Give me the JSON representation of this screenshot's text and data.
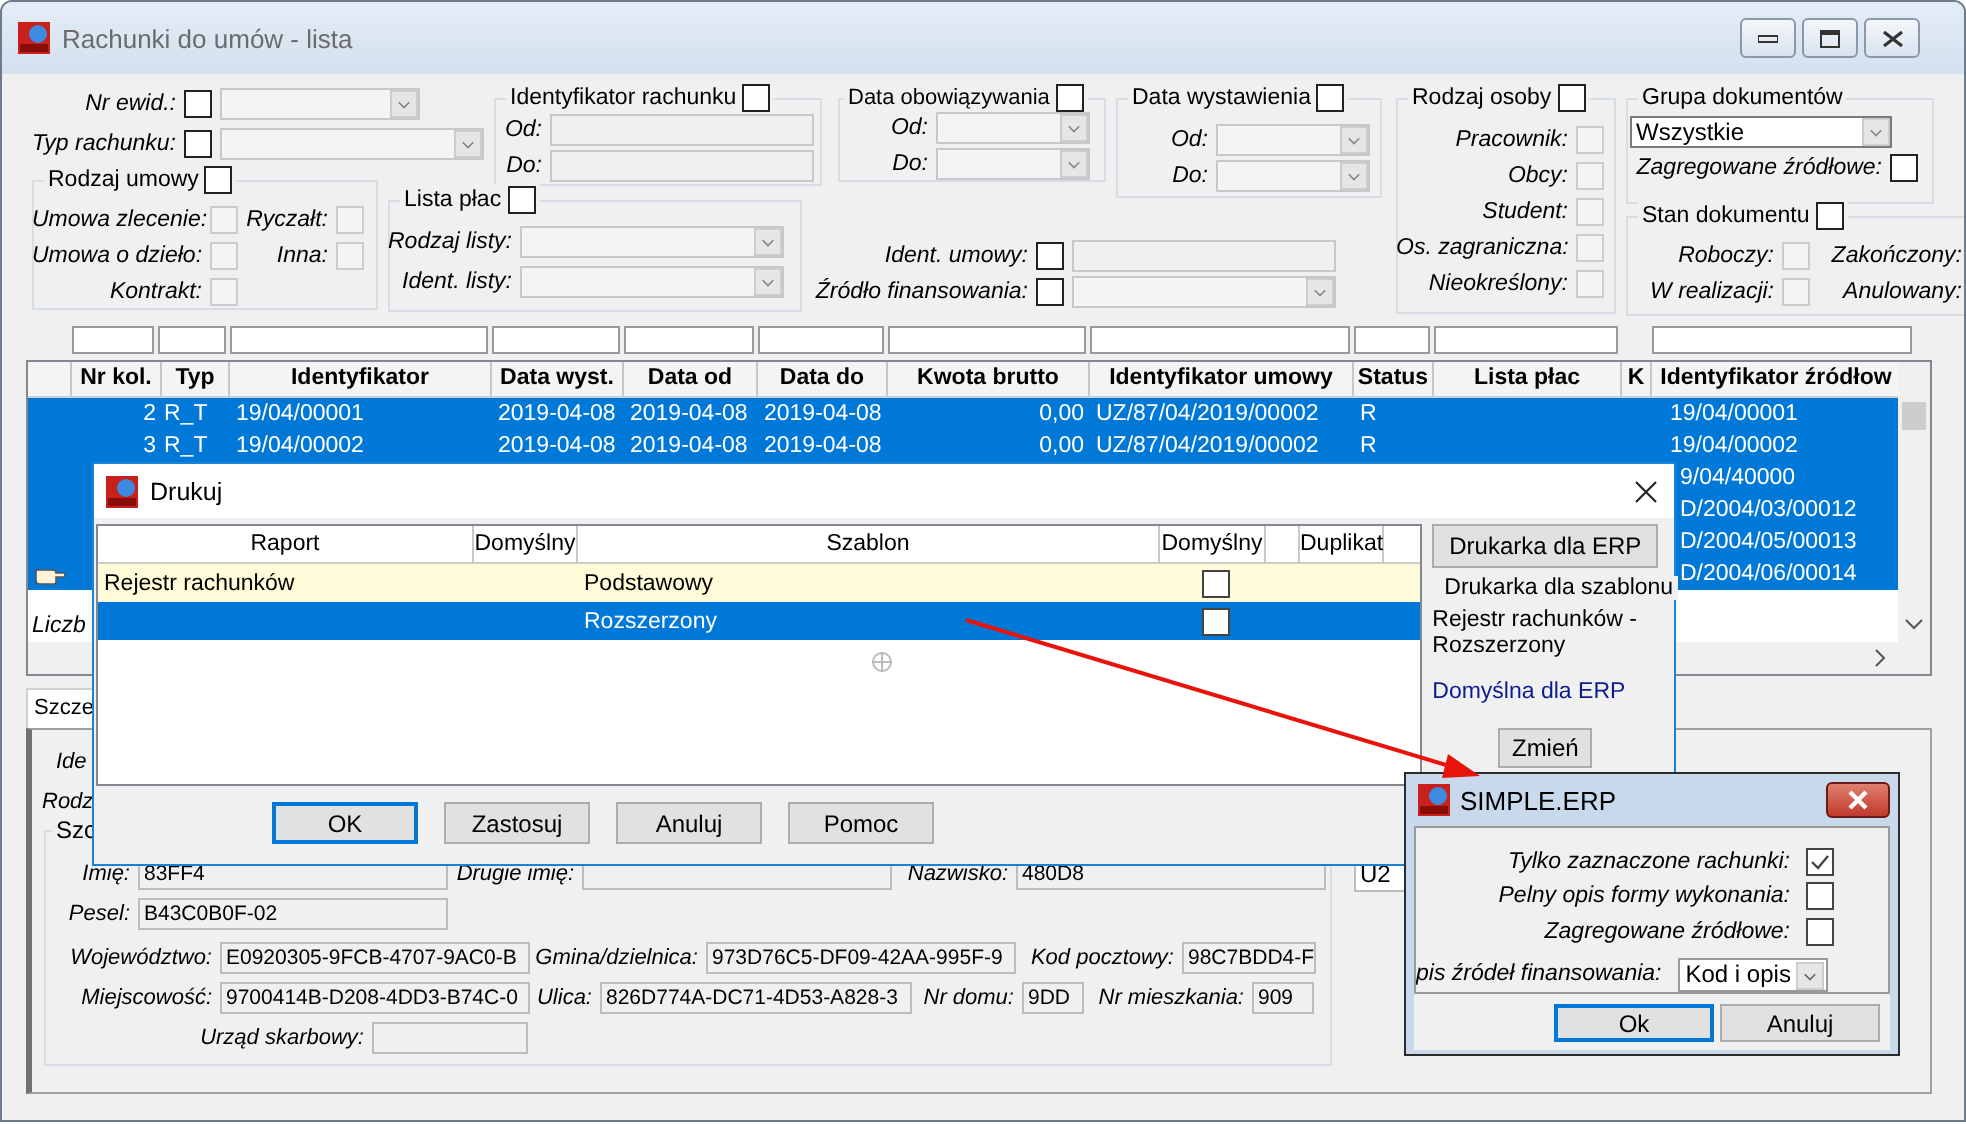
{
  "window": {
    "title": "Rachunki do umów - lista"
  },
  "filter_groups": [
    {
      "kind": "plain",
      "rows": [
        {
          "kind": "check-combo",
          "label": "Nr ewid.:",
          "checked": false,
          "disabled": true
        },
        {
          "kind": "check-combo",
          "label": "Typ rachunku:",
          "checked": false,
          "disabled": true
        }
      ]
    },
    {
      "kind": "box",
      "title": "Rodzaj umowy",
      "checked": false,
      "rows": [
        {
          "kind": "check",
          "label": "Umowa zlecenie:",
          "checked": false,
          "disabled": true
        },
        {
          "kind": "check",
          "label": "Ryczałt:",
          "checked": false,
          "disabled": true
        },
        {
          "kind": "check",
          "label": "Umowa o dzieło:",
          "checked": false,
          "disabled": true
        },
        {
          "kind": "check",
          "label": "Inna:",
          "checked": false,
          "disabled": true
        },
        {
          "kind": "check",
          "label": "Kontrakt:",
          "checked": false,
          "disabled": true
        }
      ]
    },
    {
      "kind": "box",
      "title": "Identyfikator rachunku",
      "checked": false,
      "rows": [
        {
          "kind": "text",
          "label": "Od:",
          "disabled": true
        },
        {
          "kind": "text",
          "label": "Do:",
          "disabled": true
        }
      ]
    },
    {
      "kind": "box",
      "title": "Lista płac",
      "checked": false,
      "rows": [
        {
          "kind": "combo",
          "label": "Rodzaj listy:",
          "disabled": true
        },
        {
          "kind": "combo",
          "label": "Ident. listy:",
          "disabled": true
        }
      ]
    },
    {
      "kind": "box",
      "title": "Data obowiązywania",
      "checked": false,
      "rows": [
        {
          "kind": "combo",
          "label": "Od:",
          "disabled": true
        },
        {
          "kind": "combo",
          "label": "Do:",
          "disabled": true
        }
      ]
    },
    {
      "kind": "plain",
      "rows": [
        {
          "kind": "check-text",
          "label": "Ident. umowy:",
          "checked": false,
          "disabled": true
        },
        {
          "kind": "check-combo",
          "label": "Źródło finansowania:",
          "checked": false,
          "disabled": true
        }
      ]
    },
    {
      "kind": "box",
      "title": "Data wystawienia",
      "checked": false,
      "rows": [
        {
          "kind": "combo",
          "label": "Od:",
          "disabled": true
        },
        {
          "kind": "combo",
          "label": "Do:",
          "disabled": true
        }
      ]
    },
    {
      "kind": "box",
      "title": "Rodzaj osoby",
      "checked": false,
      "rows": [
        {
          "kind": "check",
          "label": "Pracownik:",
          "checked": false,
          "disabled": true
        },
        {
          "kind": "check",
          "label": "Obcy:",
          "checked": false,
          "disabled": true
        },
        {
          "kind": "check",
          "label": "Student:",
          "checked": false,
          "disabled": true
        },
        {
          "kind": "check",
          "label": "Os. zagraniczna:",
          "checked": false,
          "disabled": true
        },
        {
          "kind": "check",
          "label": "Nieokreślony:",
          "checked": false,
          "disabled": true
        }
      ]
    },
    {
      "kind": "box",
      "title": "Grupa dokumentów",
      "rows": [
        {
          "kind": "combo",
          "value": "Wszystkie",
          "disabled": false
        },
        {
          "kind": "check",
          "label": "Zagregowane źródłowe:",
          "checked": false,
          "disabled": false
        }
      ]
    },
    {
      "kind": "box",
      "title": "Stan dokumentu",
      "checked": false,
      "rows": [
        {
          "kind": "check",
          "label": "Roboczy:",
          "checked": false,
          "disabled": true
        },
        {
          "kind": "label",
          "label": "Zakończony:"
        },
        {
          "kind": "check",
          "label": "W realizacji:",
          "checked": false,
          "disabled": true
        },
        {
          "kind": "label",
          "label": "Anulowany:"
        }
      ]
    }
  ],
  "table": {
    "columns": [
      "Nr kol.",
      "Typ",
      "Identyfikator",
      "Data wyst.",
      "Data od",
      "Data do",
      "Kwota brutto",
      "Identyfikator umowy",
      "Status",
      "Lista płac",
      "K",
      "Identyfikator źródłow"
    ],
    "rows": [
      {
        "selected": true,
        "current": false,
        "nr": "2",
        "typ": "R_T",
        "identyfikator": "19/04/00001",
        "data_wyst": "2019-04-08",
        "data_od": "2019-04-08",
        "data_do": "2019-04-08",
        "kwota": "0,00",
        "ident_umowy": "UZ/87/04/2019/00002",
        "status": "R",
        "zrodlowy": "19/04/00001"
      },
      {
        "selected": true,
        "current": false,
        "nr": "3",
        "typ": "R_T",
        "identyfikator": "19/04/00002",
        "data_wyst": "2019-04-08",
        "data_od": "2019-04-08",
        "data_do": "2019-04-08",
        "kwota": "0,00",
        "ident_umowy": "UZ/87/04/2019/00002",
        "status": "R",
        "zrodlowy": "19/04/00002"
      },
      {
        "selected": true,
        "current": false,
        "zrodlowy": "9/04/40000"
      },
      {
        "selected": true,
        "current": false,
        "zrodlowy": "D/2004/03/00012"
      },
      {
        "selected": true,
        "current": false,
        "zrodlowy": "D/2004/05/00013"
      },
      {
        "selected": true,
        "current": true,
        "zrodlowy": "D/2004/06/00014"
      }
    ],
    "footer": "Liczb"
  },
  "details": {
    "tab": "Szcze",
    "partial_labels": [
      "Ide",
      "Rodz"
    ],
    "group_title": "Szc",
    "side_value": "U2",
    "rows": [
      {
        "fields": [
          {
            "label": "Imię:",
            "value": "83FF4"
          },
          {
            "label": "Drugie imię:"
          },
          {
            "label": "Nazwisko:",
            "value": "480D8"
          }
        ]
      },
      {
        "fields": [
          {
            "label": "Pesel:",
            "value": "B43C0B0F-02"
          }
        ]
      },
      {
        "fields": [
          {
            "label": "Województwo:",
            "value": "E0920305-9FCB-4707-9AC0-B"
          },
          {
            "label": "Gmina/dzielnica:",
            "value": "973D76C5-DF09-42AA-995F-9"
          },
          {
            "label": "Kod pocztowy:",
            "value": "98C7BDD4-F"
          }
        ]
      },
      {
        "fields": [
          {
            "label": "Miejscowość:",
            "value": "9700414B-D208-4DD3-B74C-0"
          },
          {
            "label": "Ulica:",
            "value": "826D774A-DC71-4D53-A828-3"
          },
          {
            "label": "Nr domu:",
            "value": "9DD"
          },
          {
            "label": "Nr mieszkania:",
            "value": "909"
          }
        ]
      },
      {
        "fields": [
          {
            "label": "Urząd skarbowy:"
          }
        ]
      }
    ]
  },
  "print_dialog": {
    "title": "Drukuj",
    "columns": [
      "Raport",
      "Domyślny",
      "Szablon",
      "Domyślny",
      "Duplikat"
    ],
    "rows": [
      {
        "report": "Rejestr rachunków",
        "template": "Podstawowy",
        "default": false,
        "selected": false
      },
      {
        "template": "Rozszerzony",
        "default": false,
        "selected": true
      }
    ],
    "printer_button": "Drukarka dla ERP",
    "printer_group_title": "Drukarka dla szablonu",
    "printer_template": "Rejestr rachunków - Rozszerzony",
    "printer_name": "Domyślna dla ERP",
    "change_button": "Zmień",
    "buttons": [
      {
        "label": "OK",
        "default": true
      },
      {
        "label": "Zastosuj",
        "default": false
      },
      {
        "label": "Anuluj",
        "default": false
      },
      {
        "label": "Pomoc",
        "default": false
      }
    ]
  },
  "options_dialog": {
    "title": "SIMPLE.ERP",
    "options": [
      {
        "label": "Tylko zaznaczone rachunki:",
        "checked": true
      },
      {
        "label": "Pelny opis formy wykonania:",
        "checked": false
      },
      {
        "label": "Zagregowane źródłowe:",
        "checked": false
      }
    ],
    "source_label": "pis źródeł finansowania:",
    "source_value": "Kod i opis",
    "buttons": [
      {
        "label": "Ok",
        "default": true
      },
      {
        "label": "Anuluj",
        "default": false
      }
    ]
  }
}
